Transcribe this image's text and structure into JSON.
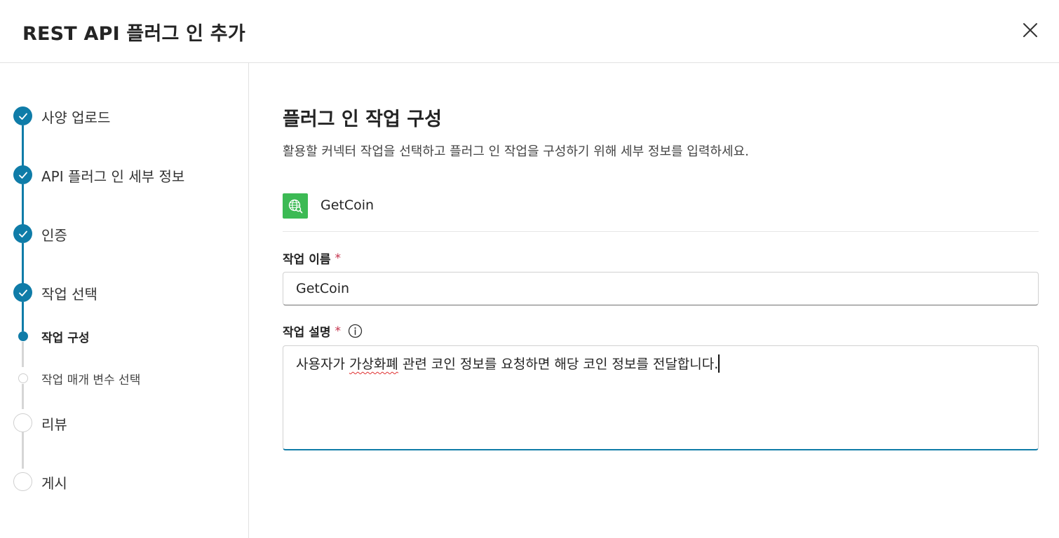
{
  "dialog": {
    "title": "REST API 플러그 인 추가"
  },
  "steps": [
    {
      "label": "사양 업로드",
      "status": "done"
    },
    {
      "label": "API 플러그 인 세부 정보",
      "status": "done"
    },
    {
      "label": "인증",
      "status": "done"
    },
    {
      "label": "작업 선택",
      "status": "done"
    },
    {
      "label": "작업 구성",
      "status": "current"
    },
    {
      "label": "작업 매개 변수 선택",
      "status": "todo"
    },
    {
      "label": "리뷰",
      "status": "todo"
    },
    {
      "label": "게시",
      "status": "todo"
    }
  ],
  "main": {
    "title": "플러그 인 작업 구성",
    "description": "활용할 커넥터 작업을 선택하고 플러그 인 작업을 구성하기 위해 세부 정보를 입력하세요.",
    "operation": {
      "name": "GetCoin",
      "icon": "globe-search-icon"
    },
    "name_field": {
      "label": "작업 이름",
      "required_mark": "*",
      "value": "GetCoin"
    },
    "description_field": {
      "label": "작업 설명",
      "required_mark": "*",
      "value_before": "사용자가 ",
      "value_misspelled": "가상화폐",
      "value_after": " 관련 코인 정보를 요청하면 해당 코인 정보를 전달합니다."
    }
  },
  "colors": {
    "accent": "#0f7ca8",
    "icon_green": "#3cba54",
    "required": "#c4314b"
  }
}
